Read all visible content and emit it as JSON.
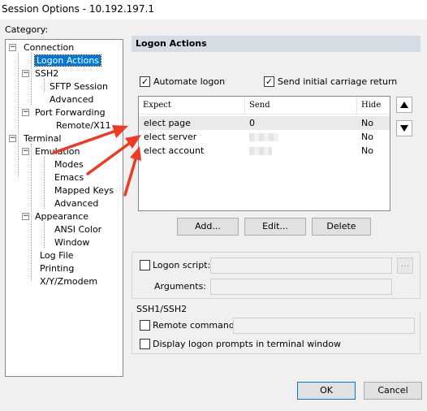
{
  "window": {
    "title": "Session Options - 10.192.197.1"
  },
  "category": {
    "label": "Category:",
    "tree": [
      "Connection",
      "Logon Actions",
      "SSH2",
      "SFTP Session",
      "Advanced",
      "Port Forwarding",
      "Remote/X11",
      "Terminal",
      "Emulation",
      "Modes",
      "Emacs",
      "Mapped Keys",
      "Advanced",
      "Appearance",
      "ANSI Color",
      "Window",
      "Log File",
      "Printing",
      "X/Y/Zmodem"
    ]
  },
  "panel": {
    "title": "Logon Actions",
    "automate_logon": {
      "label": "Automate logon",
      "checked": true
    },
    "send_cr": {
      "label": "Send initial carriage return",
      "checked": true
    },
    "table": {
      "columns": [
        "Expect",
        "Send",
        "Hide"
      ],
      "rows": [
        {
          "expect": "elect page",
          "send": "0",
          "hide": "No"
        },
        {
          "expect": "elect server",
          "send": "",
          "hide": "No"
        },
        {
          "expect": "elect account",
          "send": "",
          "hide": "No"
        }
      ]
    },
    "buttons": {
      "add": "Add...",
      "edit": "Edit...",
      "delete": "Delete"
    },
    "logon_script": {
      "label": "Logon script:",
      "value": "",
      "browse": "..."
    },
    "arguments": {
      "label": "Arguments:",
      "value": ""
    },
    "ssh_group": {
      "title": "SSH1/SSH2",
      "remote_command": {
        "label": "Remote command:",
        "value": ""
      },
      "display_prompts": {
        "label": "Display logon prompts in terminal window"
      }
    }
  },
  "footer": {
    "ok": "OK",
    "cancel": "Cancel"
  },
  "colors": {
    "selection": "#0078d7",
    "header_bg": "#d6dce4",
    "annotation_arrow": "#ee3a24"
  }
}
